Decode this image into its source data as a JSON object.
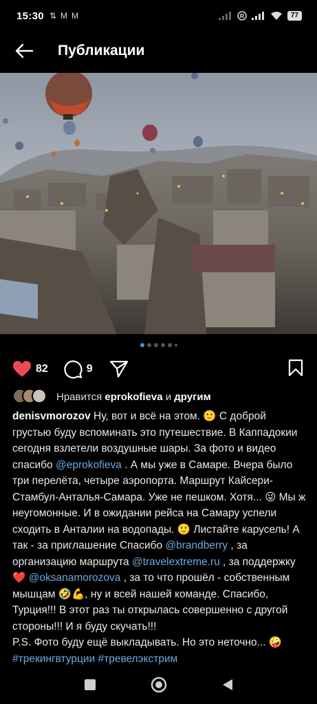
{
  "status_bar": {
    "time": "15:30",
    "left_icons": [
      "sync-icon",
      "mail-icon",
      "mail-icon"
    ],
    "battery": "77"
  },
  "header": {
    "title": "Публикации",
    "back_icon": "arrow-left-icon"
  },
  "post": {
    "image_description_icon": "photo",
    "carousel": {
      "total_dots": 6,
      "active_index": 0
    },
    "actions": {
      "likes_count": "82",
      "comments_count": "9"
    },
    "liked_by": {
      "prefix": "Нравится ",
      "user": "eprokofieva",
      "connector": " и ",
      "suffix": "другим"
    },
    "caption": {
      "username": "denisvmorozov",
      "part1": " Ну, вот и всё на этом. 🙂 С доброй грустью буду вспоминать это путешествие. В Каппадокии сегодня взлетели воздушные шары. За фото и видео спасибо ",
      "mention1": "@eprokofieva",
      "part2": " . А мы уже в Самаре. Вчера было три перелёта, четыре аэропорта. Маршрут Кайсери-Стамбул-Анталья-Самара. Уже не пешком. Хотя... 😜 Мы ж неугомонные. И в ожидании рейса на Самару успели сходить в Анталии на водопады. 🙂 Листайте карусель! А так - за приглашение Спасибо ",
      "mention2": "@brandberry",
      "part3": " , за организацию маршрута ",
      "mention3": "@travelextreme.ru",
      "part4": " , за поддержку ❤️ ",
      "mention4": "@oksanamorozova",
      "part5": " , за то что прошёл - собственным мышцам 🤣💪, ну и всей нашей команде. Спасибо, Турция!!! В этот раз ты открылась совершенно с другой стороны!!! И я буду скучать!!!",
      "part6": "P.S. Фото буду ещё выкладывать. Но это неточно... 🤪",
      "hashtag1": "#трекингвтурции",
      "hashtag2": "#тревелэкстрим"
    }
  },
  "nav_bar": {
    "buttons": [
      "recents-square-icon",
      "home-circle-icon",
      "back-triangle-icon"
    ]
  },
  "colors": {
    "background": "#000000",
    "like_red": "#ed4956",
    "link_blue": "#6fa8dc",
    "dot_active": "#3897f0"
  }
}
